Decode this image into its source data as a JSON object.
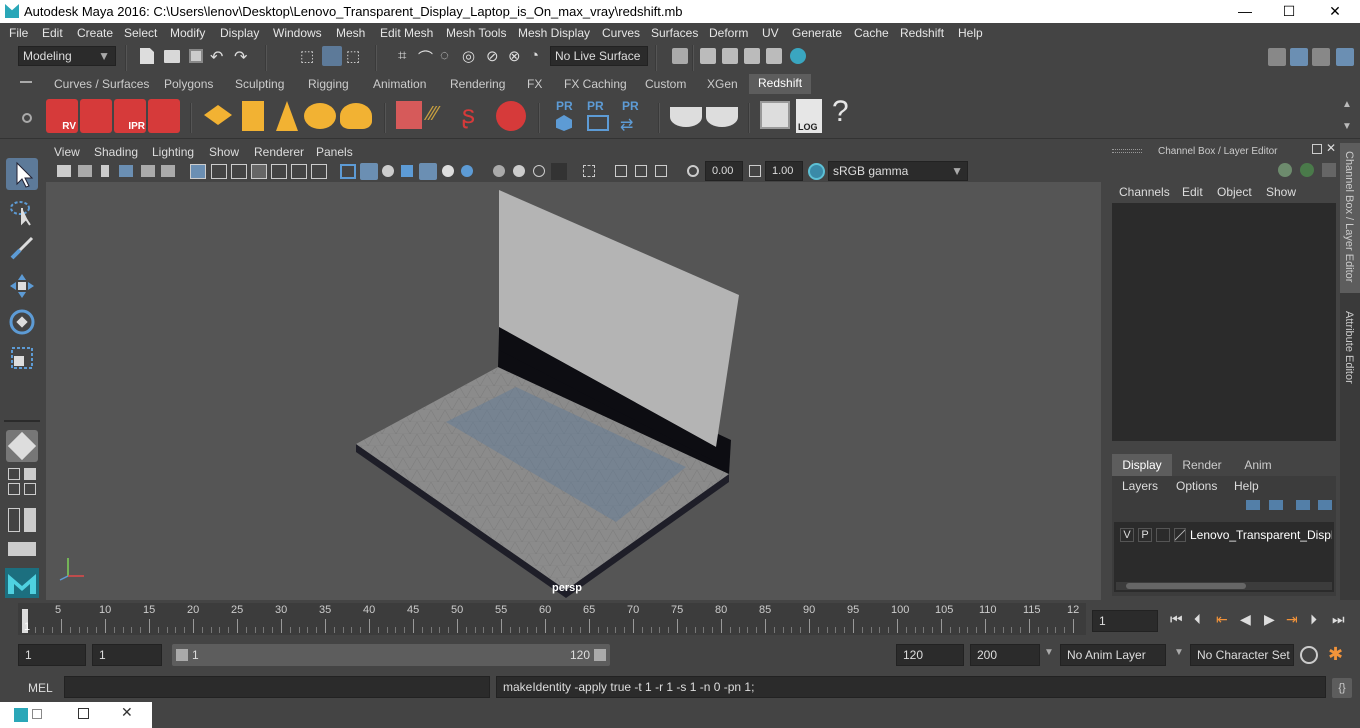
{
  "title_bar": {
    "title": "Autodesk Maya 2016: C:\\Users\\lenov\\Desktop\\Lenovo_Transparent_Display_Laptop_is_On_max_vray\\redshift.mb",
    "minimize": "—",
    "maximize": "☐",
    "close": "✕"
  },
  "menu": [
    "File",
    "Edit",
    "Create",
    "Select",
    "Modify",
    "Display",
    "Windows",
    "Mesh",
    "Edit Mesh",
    "Mesh Tools",
    "Mesh Display",
    "Curves",
    "Surfaces",
    "Deform",
    "UV",
    "Generate",
    "Cache",
    "Redshift",
    "Help"
  ],
  "status_line": {
    "mode": "Modeling",
    "live_surface": "No Live Surface"
  },
  "shelf_tabs": [
    "Curves / Surfaces",
    "Polygons",
    "Sculpting",
    "Rigging",
    "Animation",
    "Rendering",
    "FX",
    "FX Caching",
    "Custom",
    "XGen",
    "Redshift"
  ],
  "shelf_active": "Redshift",
  "shelf_labels": {
    "rv": "RV",
    "ipr": "IPR",
    "pr1": "PR",
    "pr2": "PR",
    "pr3": "PR",
    "log": "LOG",
    "help": "?"
  },
  "panel_menu": [
    "View",
    "Shading",
    "Lighting",
    "Show",
    "Renderer",
    "Panels"
  ],
  "panel_tools": {
    "exposure": "0.00",
    "gamma": "1.00",
    "color_space": "sRGB gamma"
  },
  "viewport": {
    "camera_label": "persp"
  },
  "channel_box": {
    "title": "Channel Box / Layer Editor",
    "menus": [
      "Channels",
      "Edit",
      "Object",
      "Show"
    ],
    "layer_tabs": [
      "Display",
      "Render",
      "Anim"
    ],
    "layer_tab_active": "Display",
    "layer_menus": [
      "Layers",
      "Options",
      "Help"
    ],
    "layer_row": {
      "v": "V",
      "p": "P",
      "name": "Lenovo_Transparent_Displa"
    }
  },
  "side_tabs": [
    "Channel Box / Layer Editor",
    "Attribute Editor"
  ],
  "timeline": {
    "ticks": [
      "5",
      "10",
      "15",
      "20",
      "25",
      "30",
      "35",
      "40",
      "45",
      "50",
      "55",
      "60",
      "65",
      "70",
      "75",
      "80",
      "85",
      "90",
      "95",
      "100",
      "105",
      "110",
      "115",
      "12"
    ],
    "start_marker": "1",
    "current_frame": "1"
  },
  "range": {
    "start": "1",
    "anim_start": "1",
    "slider_start": "1",
    "slider_end": "120",
    "end": "120",
    "anim_end": "200",
    "anim_layer": "No Anim Layer",
    "char_set": "No Character Set"
  },
  "cmd": {
    "label": "MEL",
    "result": "makeIdentity -apply true -t 1 -r 1 -s 1 -n 0 -pn 1;"
  },
  "colors": {
    "bg": "#444444",
    "viewport": "#555555",
    "accent": "#5d9bd5",
    "redshift_red": "#d63a3a"
  }
}
